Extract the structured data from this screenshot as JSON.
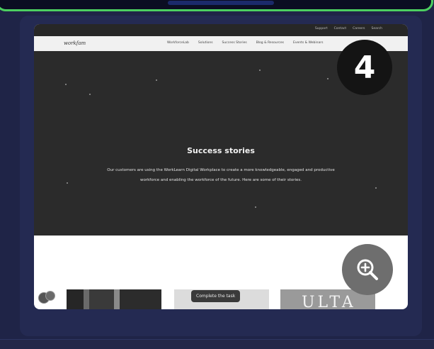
{
  "gallery": {
    "step_number": "4",
    "tooltip": "Complete the task"
  },
  "site": {
    "logo": "workfam",
    "utility_links": [
      "Support",
      "Contact",
      "Careers",
      "Search"
    ],
    "nav_items": [
      "WorkforceLab",
      "Solutions",
      "Success Stories",
      "Blog & Resources",
      "Events & Webinars"
    ],
    "hero_title": "Success stories",
    "hero_text": "Our customers are using the WorkLearn Digital Workplace to create a more knowledgeable, engaged and productive workforce and enabling the workforce of the future. Here are some of their stories.",
    "thumb3_text": "ULTA"
  },
  "icons": {
    "zoom": "zoom-in-icon",
    "badge": "badge-icon"
  }
}
